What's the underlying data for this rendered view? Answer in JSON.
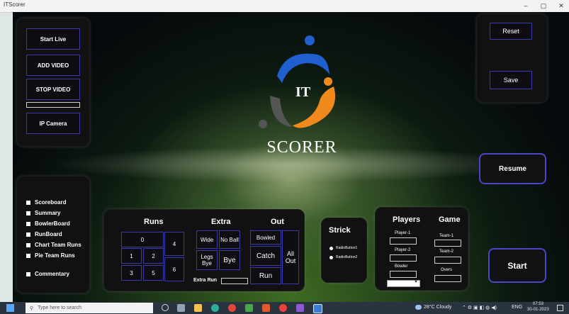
{
  "window": {
    "title": "ITScorer",
    "minimize": "–",
    "maximize": "▢",
    "close": "✕"
  },
  "logo": {
    "it_text": "IT",
    "name": "SCORER"
  },
  "media": {
    "start_live": "Start Live",
    "add_video": "ADD VIDEO",
    "stop_video": "STOP VIDEO",
    "ip_camera": "IP Camera"
  },
  "right": {
    "reset": "Reset",
    "save": "Save",
    "resume": "Resume",
    "start": "Start"
  },
  "boards": [
    {
      "label": "Scoreboard"
    },
    {
      "label": "Summary"
    },
    {
      "label": "BowlerBoard"
    },
    {
      "label": "RunBoard"
    },
    {
      "label": "Chart Team Runs"
    },
    {
      "label": "Pie Team Runs"
    },
    {
      "label": "Commentary"
    }
  ],
  "scoring": {
    "runs_title": "Runs",
    "extra_title": "Extra",
    "out_title": "Out",
    "runs": [
      "0",
      "4",
      "1",
      "2",
      "3",
      "5",
      "6"
    ],
    "extra": {
      "wide": "Wide",
      "no_ball": "No Ball",
      "legs_bye": "Legs Bye",
      "bye": "Bye",
      "extra_run": "Extra Run"
    },
    "out": {
      "bowled": "Bowled",
      "catch": "Catch",
      "run": "Run",
      "all_out": "All Out"
    }
  },
  "strick": {
    "title": "Strick",
    "radio1": "RadioButton1",
    "radio2": "RadioButton2"
  },
  "players": {
    "title": "Players",
    "game_title": "Game",
    "player1": "Player-1",
    "player2": "Player-2",
    "bowler": "Bowler",
    "team1": "Team-1",
    "team2": "Team-2",
    "overs": "Overs"
  },
  "taskbar": {
    "search_placeholder": "Type here to search",
    "weather": "28°C  Cloudy",
    "language": "ENG",
    "time": "07:53",
    "date": "30-01-2023"
  },
  "colors": {
    "accent_border": "#3a3aa8",
    "logo_blue": "#1f5fd0",
    "logo_orange": "#f08a1c",
    "panel": "#111111"
  }
}
